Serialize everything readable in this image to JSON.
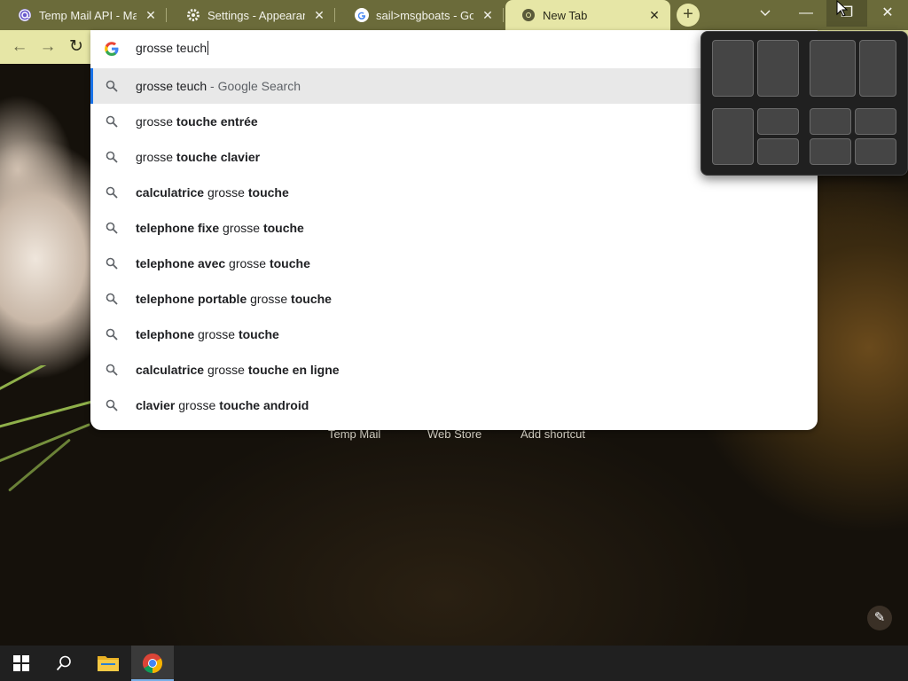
{
  "tabs": [
    {
      "title": "Temp Mail API - Mail.t",
      "icon": "at-sign-icon",
      "active": false
    },
    {
      "title": "Settings - Appearance",
      "icon": "gear-icon",
      "active": false
    },
    {
      "title": "sail>msgboats - Goog",
      "icon": "google-icon",
      "active": false
    },
    {
      "title": "New Tab",
      "icon": "chrome-icon",
      "active": true
    }
  ],
  "window": {
    "tab_search_icon": "chevron-down-icon",
    "minimize_glyph": "—",
    "maximize_glyph": "❐",
    "close_glyph": "✕"
  },
  "toolbar": {
    "back_glyph": "←",
    "forward_glyph": "→",
    "reload_glyph": "↻"
  },
  "omnibox": {
    "value": "grosse teuch",
    "suggestions": [
      {
        "parts": [
          {
            "t": "grosse teuch",
            "b": false
          }
        ],
        "hint": " - Google Search",
        "selected": true
      },
      {
        "parts": [
          {
            "t": "grosse ",
            "b": false
          },
          {
            "t": "touche entrée",
            "b": true
          }
        ]
      },
      {
        "parts": [
          {
            "t": "grosse ",
            "b": false
          },
          {
            "t": "touche clavier",
            "b": true
          }
        ]
      },
      {
        "parts": [
          {
            "t": "calculatrice",
            "b": true
          },
          {
            "t": " grosse ",
            "b": false
          },
          {
            "t": "touche",
            "b": true
          }
        ]
      },
      {
        "parts": [
          {
            "t": "telephone fixe",
            "b": true
          },
          {
            "t": " grosse ",
            "b": false
          },
          {
            "t": "touche",
            "b": true
          }
        ]
      },
      {
        "parts": [
          {
            "t": "telephone avec",
            "b": true
          },
          {
            "t": " grosse ",
            "b": false
          },
          {
            "t": "touche",
            "b": true
          }
        ]
      },
      {
        "parts": [
          {
            "t": "telephone portable",
            "b": true
          },
          {
            "t": " grosse ",
            "b": false
          },
          {
            "t": "touche",
            "b": true
          }
        ]
      },
      {
        "parts": [
          {
            "t": "telephone",
            "b": true
          },
          {
            "t": " grosse ",
            "b": false
          },
          {
            "t": "touche",
            "b": true
          }
        ]
      },
      {
        "parts": [
          {
            "t": "calculatrice",
            "b": true
          },
          {
            "t": " grosse ",
            "b": false
          },
          {
            "t": "touche en ligne",
            "b": true
          }
        ]
      },
      {
        "parts": [
          {
            "t": "clavier",
            "b": true
          },
          {
            "t": " grosse ",
            "b": false
          },
          {
            "t": "touche android",
            "b": true
          }
        ]
      }
    ]
  },
  "shortcuts": [
    "Temp Mail",
    "Web Store",
    "Add shortcut"
  ],
  "customize": {
    "glyph": "✎"
  },
  "taskbar": {
    "items": [
      "windows-start-icon",
      "search-icon",
      "file-explorer-icon",
      "chrome-icon"
    ]
  },
  "colors": {
    "tabstrip": "#6b6b3a",
    "toolbar": "#e6e6a6",
    "accent": "#1a73e8"
  }
}
